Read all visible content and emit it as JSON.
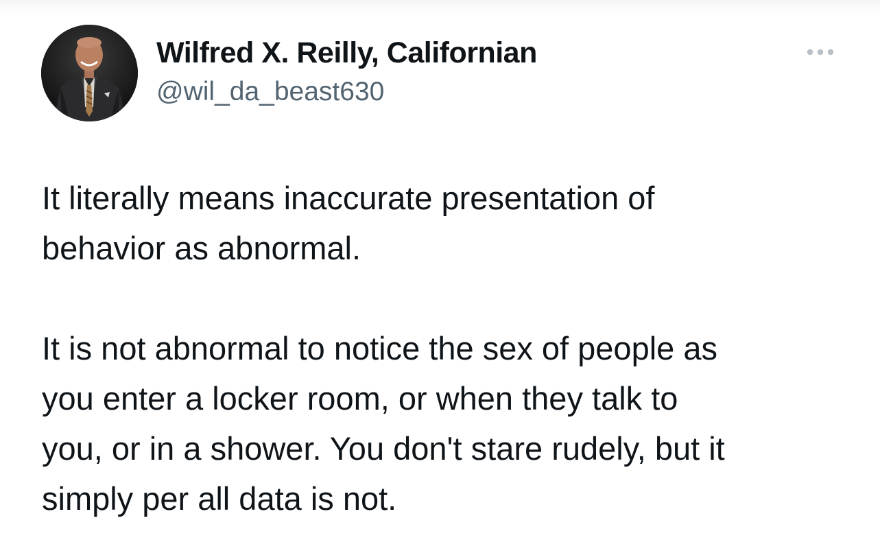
{
  "tweet": {
    "author": {
      "display_name": "Wilfred X. Reilly, Californian",
      "handle": "@wil_da_beast630",
      "avatar_icon": "profile-photo"
    },
    "more_icon": "more-horizontal-icon",
    "paragraphs": [
      "It literally means inaccurate presentation of\nbehavior as abnormal.",
      "It is not abnormal to notice the sex of people as\nyou enter a locker room, or when they talk to\nyou, or in a shower. You don't stare rudely, but it\nsimply per all data is not."
    ]
  },
  "colors": {
    "text": "#0f1419",
    "secondary_text": "#536471",
    "background": "#ffffff"
  }
}
